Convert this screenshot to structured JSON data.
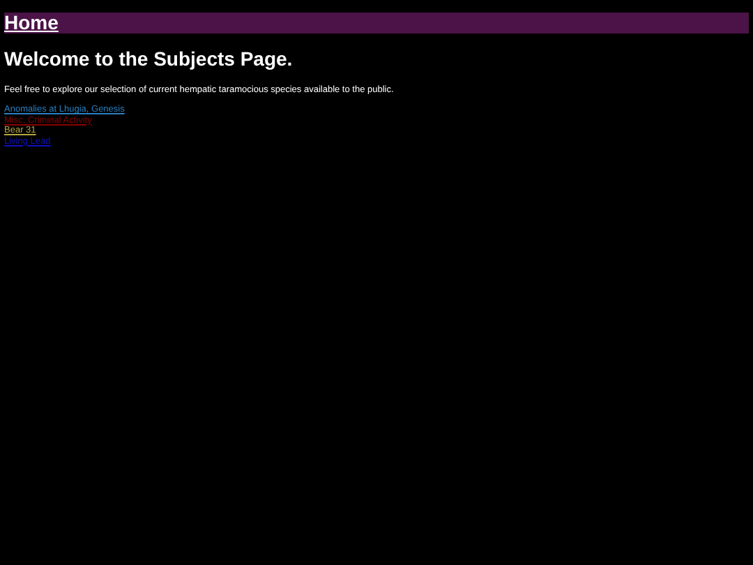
{
  "header": {
    "home_link": "Home"
  },
  "title": "Welcome to the Subjects Page.",
  "intro": "Feel free to explore our selection of current hempatic taramocious species available to the public.",
  "links": [
    {
      "label": "Anomalies at Lhugia, Genesis",
      "color": "#2a7fc0"
    },
    {
      "label": "Misc. Criminal Activity",
      "color": "#8b0000"
    },
    {
      "label": "Bear 31",
      "color": "#b5a642"
    },
    {
      "label": "Living Lead",
      "color": "#1010c0"
    }
  ]
}
